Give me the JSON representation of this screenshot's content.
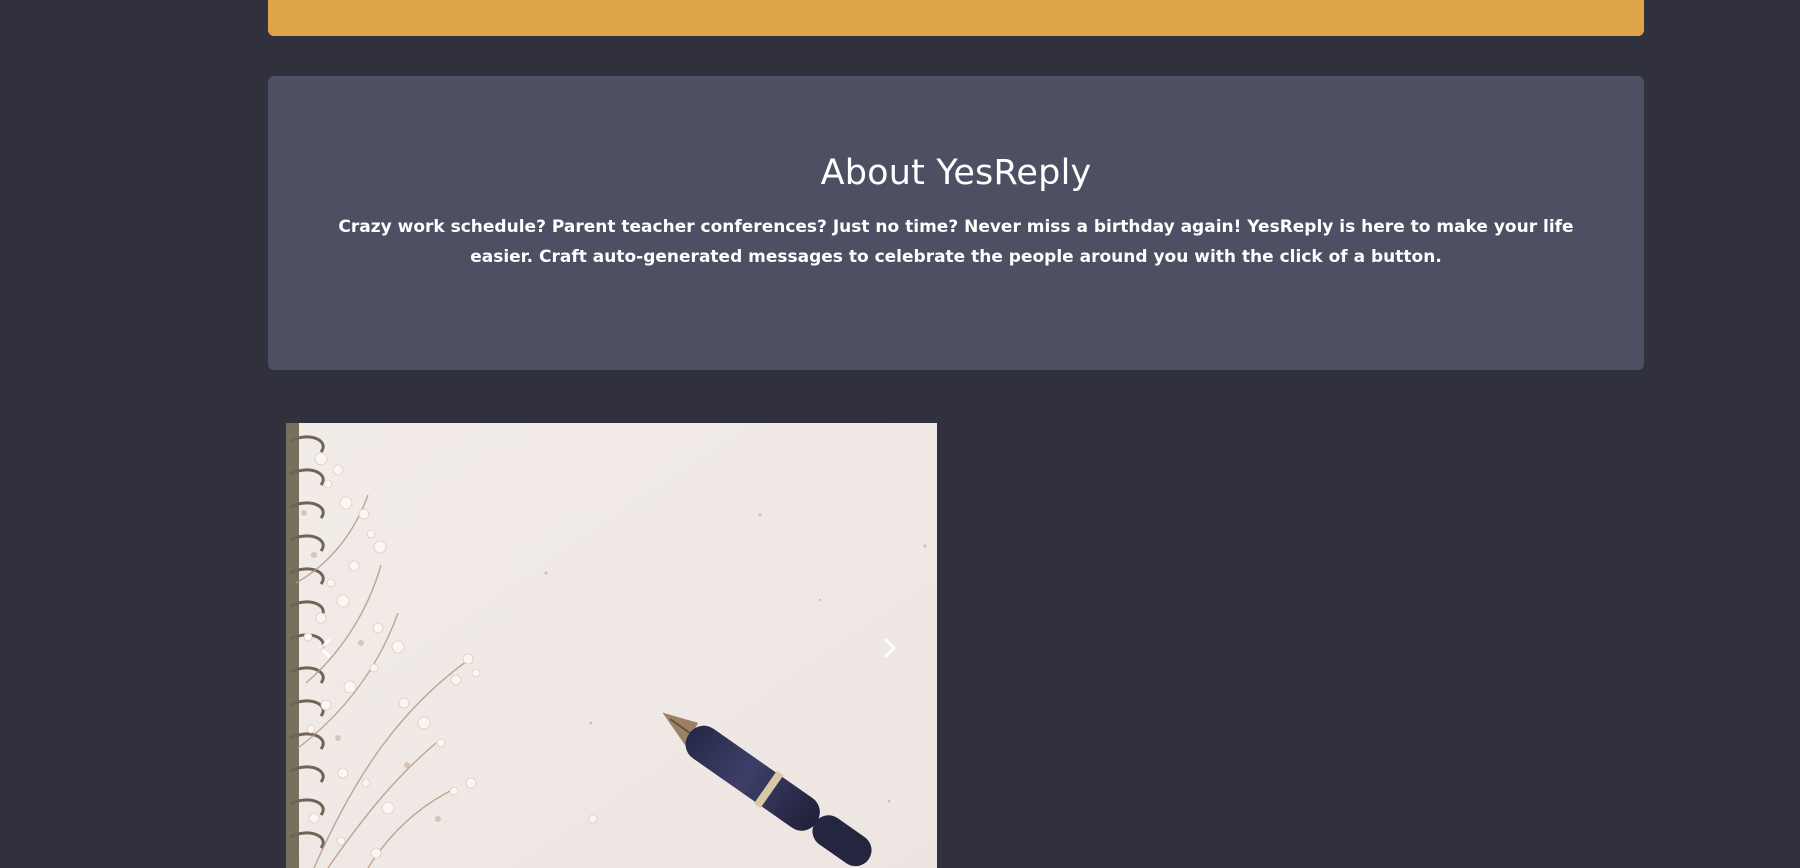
{
  "about": {
    "title": "About YesReply",
    "description": "Crazy work schedule? Parent teacher conferences? Just no time? Never miss a birthday again! YesReply is here to make your life easier. Craft auto-generated messages to celebrate the people around you with the click of a button."
  },
  "carousel": {
    "prev_icon": "chevron-left-icon",
    "next_icon": "chevron-right-icon"
  },
  "colors": {
    "background": "#30313d",
    "banner": "#dfa448",
    "card": "#4d5063",
    "text": "#ffffff"
  }
}
